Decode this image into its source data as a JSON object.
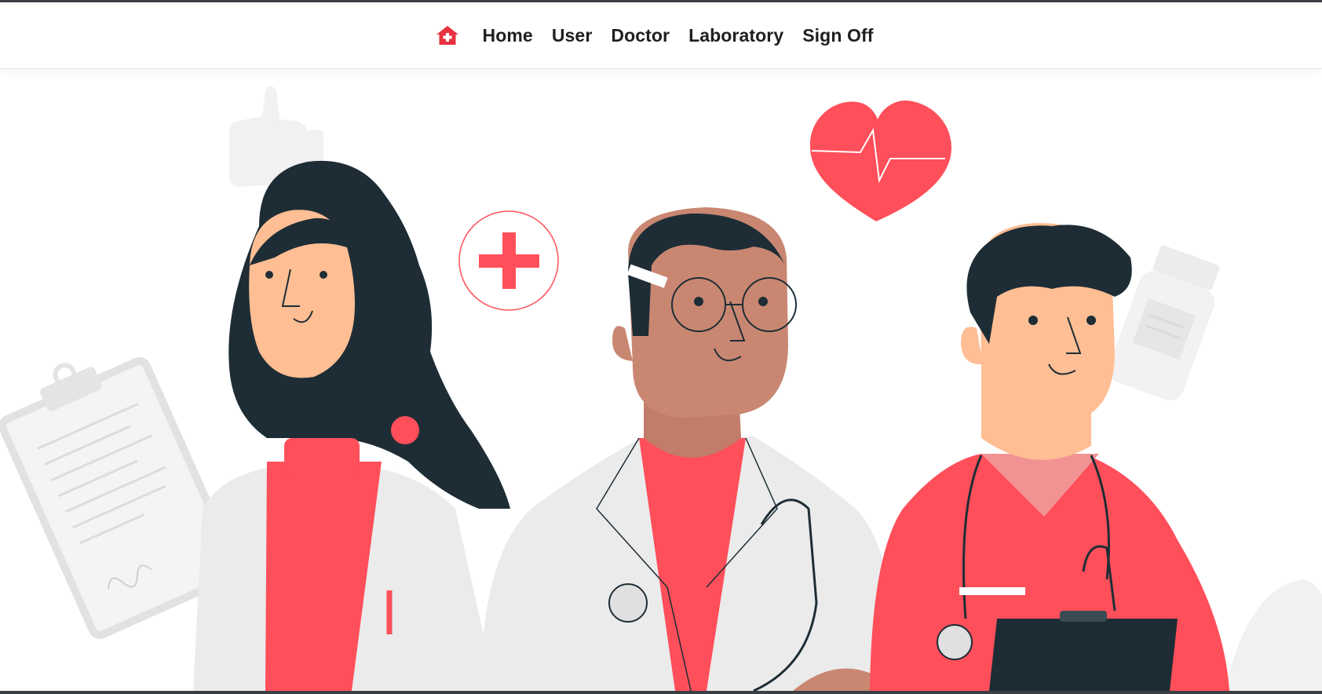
{
  "nav": {
    "brand_icon": "hospital-home-icon",
    "links": [
      {
        "label": "Home"
      },
      {
        "label": "User"
      },
      {
        "label": "Doctor"
      },
      {
        "label": "Laboratory"
      },
      {
        "label": "Sign Off"
      }
    ]
  },
  "hero": {
    "illustration": "three-medical-professionals",
    "icons": [
      "thumbs-up-icon",
      "clipboard-icon",
      "heart-pulse-icon",
      "medical-cross-icon",
      "pill-bottle-icon",
      "stethoscope-icon"
    ]
  },
  "colors": {
    "accent": "#ff4f5a",
    "navy": "#1e2d35",
    "text": "#1f1f1f",
    "coat": "#ebebeb"
  }
}
